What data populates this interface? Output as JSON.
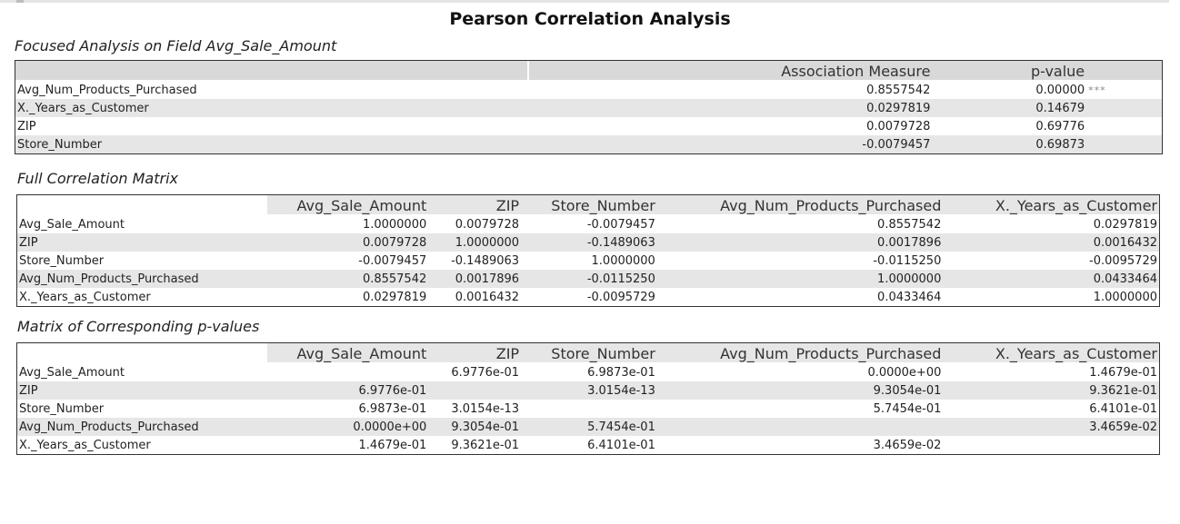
{
  "title": "Pearson Correlation Analysis",
  "focused": {
    "heading": "Focused Analysis on Field Avg_Sale_Amount",
    "col_measure": "Association Measure",
    "col_pvalue": "p-value",
    "rows": [
      {
        "name": "Avg_Num_Products_Purchased",
        "measure": "0.8557542",
        "pvalue": "0.00000",
        "sig": "***"
      },
      {
        "name": "X._Years_as_Customer",
        "measure": "0.0297819",
        "pvalue": "0.14679",
        "sig": ""
      },
      {
        "name": "ZIP",
        "measure": "0.0079728",
        "pvalue": "0.69776",
        "sig": ""
      },
      {
        "name": "Store_Number",
        "measure": "-0.0079457",
        "pvalue": "0.69873",
        "sig": ""
      }
    ]
  },
  "matrix": {
    "heading": "Full Correlation Matrix",
    "columns": [
      "Avg_Sale_Amount",
      "ZIP",
      "Store_Number",
      "Avg_Num_Products_Purchased",
      "X._Years_as_Customer"
    ],
    "rows": [
      {
        "name": "Avg_Sale_Amount",
        "values": [
          "1.0000000",
          "0.0079728",
          "-0.0079457",
          "0.8557542",
          "0.0297819"
        ]
      },
      {
        "name": "ZIP",
        "values": [
          "0.0079728",
          "1.0000000",
          "-0.1489063",
          "0.0017896",
          "0.0016432"
        ]
      },
      {
        "name": "Store_Number",
        "values": [
          "-0.0079457",
          "-0.1489063",
          "1.0000000",
          "-0.0115250",
          "-0.0095729"
        ]
      },
      {
        "name": "Avg_Num_Products_Purchased",
        "values": [
          "0.8557542",
          "0.0017896",
          "-0.0115250",
          "1.0000000",
          "0.0433464"
        ]
      },
      {
        "name": "X._Years_as_Customer",
        "values": [
          "0.0297819",
          "0.0016432",
          "-0.0095729",
          "0.0433464",
          "1.0000000"
        ]
      }
    ]
  },
  "pmatrix": {
    "heading": "Matrix of Corresponding p-values",
    "columns": [
      "Avg_Sale_Amount",
      "ZIP",
      "Store_Number",
      "Avg_Num_Products_Purchased",
      "X._Years_as_Customer"
    ],
    "rows": [
      {
        "name": "Avg_Sale_Amount",
        "values": [
          "",
          "6.9776e-01",
          "6.9873e-01",
          "0.0000e+00",
          "1.4679e-01"
        ]
      },
      {
        "name": "ZIP",
        "values": [
          "6.9776e-01",
          "",
          "3.0154e-13",
          "9.3054e-01",
          "9.3621e-01"
        ]
      },
      {
        "name": "Store_Number",
        "values": [
          "6.9873e-01",
          "3.0154e-13",
          "",
          "5.7454e-01",
          "6.4101e-01"
        ]
      },
      {
        "name": "Avg_Num_Products_Purchased",
        "values": [
          "0.0000e+00",
          "9.3054e-01",
          "5.7454e-01",
          "",
          "3.4659e-02"
        ]
      },
      {
        "name": "X._Years_as_Customer",
        "values": [
          "1.4679e-01",
          "9.3621e-01",
          "6.4101e-01",
          "3.4659e-02",
          ""
        ]
      }
    ]
  }
}
